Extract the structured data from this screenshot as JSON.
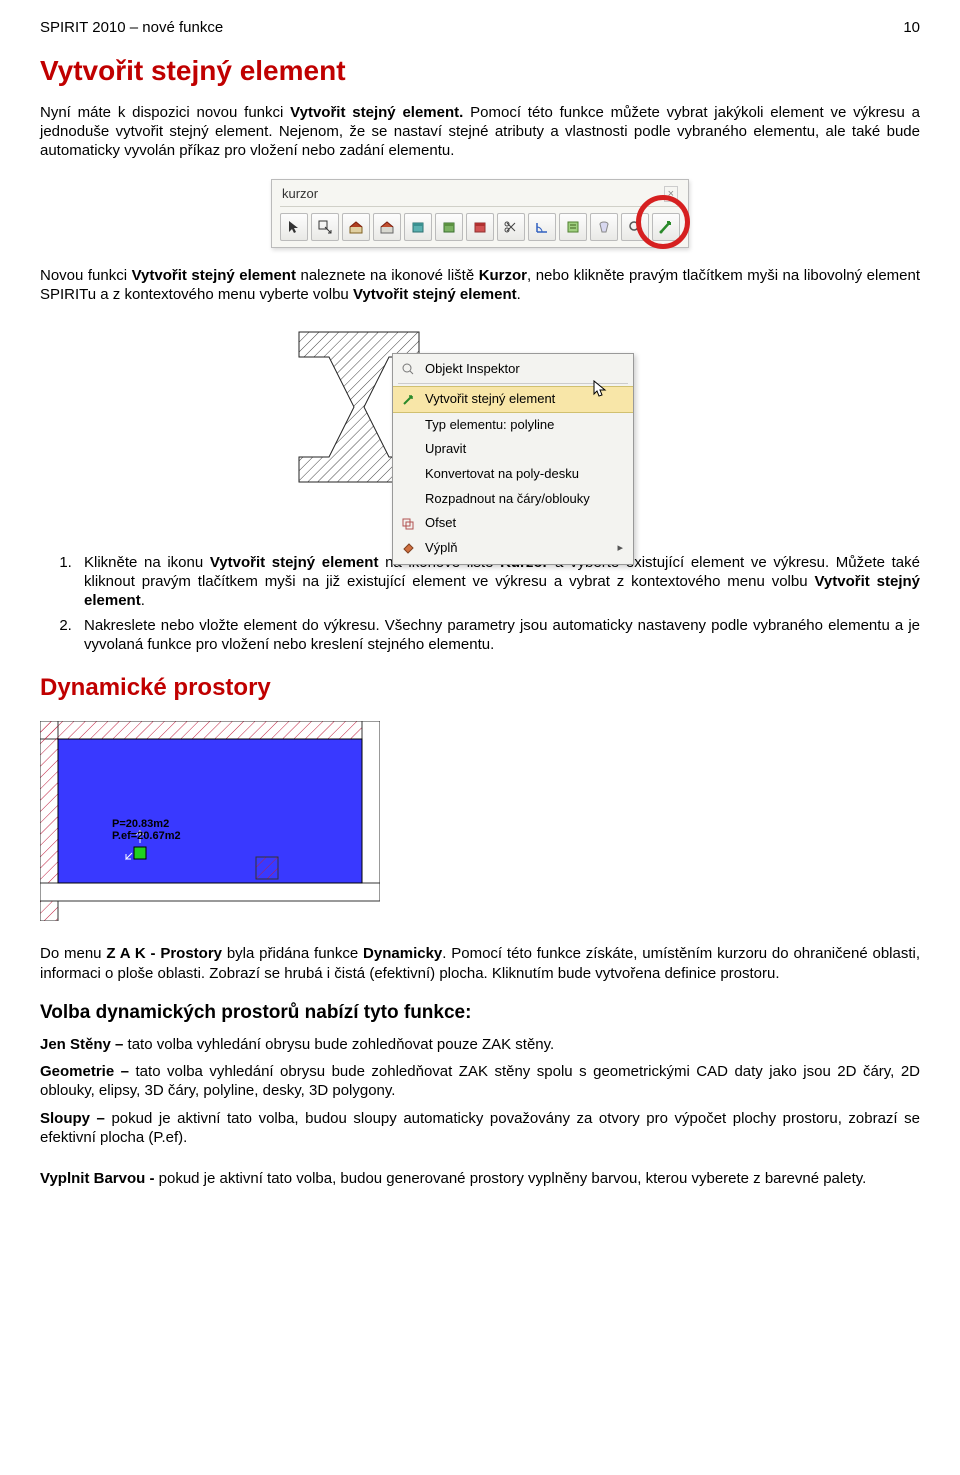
{
  "header": {
    "doc_title": "SPIRIT 2010 – nové funkce",
    "page": "10"
  },
  "section1": {
    "title": "Vytvořit stejný element",
    "intro_before": "Nyní máte k dispozici novou funkci ",
    "intro_b1": "Vytvořit stejný element.",
    "intro_after": " Pomocí této funkce můžete vybrat jakýkoli element ve výkresu a jednoduše vytvořit stejný element. Nejenom, že se nastaví stejné atributy a vlastnosti podle vybraného elementu, ale také bude automaticky vyvolán příkaz pro vložení nebo zadání elementu.",
    "toolbar_label": "kurzor",
    "toolbar_icons": [
      "pointer-icon",
      "select-rect-icon",
      "house-icon",
      "house2-icon",
      "stack-cyan-icon",
      "stack-green-icon",
      "stack-red-icon",
      "scissors-icon",
      "angle-icon",
      "note-green-icon",
      "glass-icon",
      "magnifier-icon",
      "create-same-icon"
    ],
    "para2_before": "Novou funkci ",
    "para2_b1": "Vytvořit stejný element",
    "para2_mid1": " naleznete na ikonové liště ",
    "para2_b2": "Kurzor",
    "para2_mid2": ", nebo klikněte pravým tlačítkem myši na libovolný element SPIRITu a z kontextového menu vyberte volbu ",
    "para2_b3": "Vytvořit stejný element",
    "para2_end": ".",
    "ctx_menu": {
      "items": [
        {
          "label": "Objekt Inspektor"
        },
        {
          "label": "Vytvořit stejný element",
          "highlight": true
        },
        {
          "label": "Typ elementu: polyline"
        },
        {
          "label": "Upravit"
        },
        {
          "label": "Konvertovat na poly-desku"
        },
        {
          "label": "Rozpadnout na čáry/oblouky"
        },
        {
          "label": "Ofset"
        },
        {
          "label": "Výplň",
          "sub": "▸"
        }
      ]
    },
    "steps": {
      "s1_a": "Klikněte na ikonu ",
      "s1_b1": "Vytvořit stejný element",
      "s1_b": " na ikonové liště ",
      "s1_b2": "Kurzor",
      "s1_c": " a vyberte existující element ve výkresu. Můžete také kliknout pravým tlačítkem myši na již existující element ve výkresu a vybrat z kontextového menu volbu ",
      "s1_b3": "Vytvořit stejný element",
      "s1_d": ".",
      "s2": "Nakreslete nebo vložte element do výkresu. Všechny parametry jsou automaticky nastaveny podle vybraného elementu a je vyvolaná funkce pro vložení nebo kreslení stejného elementu."
    }
  },
  "section2": {
    "title": "Dynamické prostory",
    "room": {
      "line1": "P=20.83m2",
      "line2": "P.ef=20.67m2"
    },
    "para_a": "Do menu ",
    "para_b1": "Z A K - Prostory",
    "para_b": " byla přidána funkce ",
    "para_b2": "Dynamicky",
    "para_c": ". Pomocí této funkce získáte, umístěním kurzoru do ohraničené oblasti, informaci o ploše oblasti. Zobrazí se hrubá i čistá (efektivní) plocha. Kliknutím bude vytvořena definice prostoru.",
    "subhead": "Volba dynamických prostorů nabízí tyto funkce:",
    "opt1_b": "Jen Stěny –",
    "opt1_t": " tato volba vyhledání obrysu bude zohledňovat pouze ZAK stěny.",
    "opt2_b": "Geometrie –",
    "opt2_t": " tato volba vyhledání obrysu bude zohledňovat ZAK stěny spolu s geometrickými CAD daty jako jsou 2D čáry, 2D oblouky, elipsy, 3D čáry, polyline, desky, 3D polygony.",
    "opt3_b": "Sloupy –",
    "opt3_t": " pokud je aktivní tato volba, budou sloupy automaticky považovány za otvory pro výpočet plochy prostoru, zobrazí se efektivní plocha (P.ef).",
    "opt4_b": "Vyplnit Barvou -",
    "opt4_t": " pokud je aktivní tato volba, budou generované prostory vyplněny barvou, kterou vyberete z barevné palety."
  }
}
